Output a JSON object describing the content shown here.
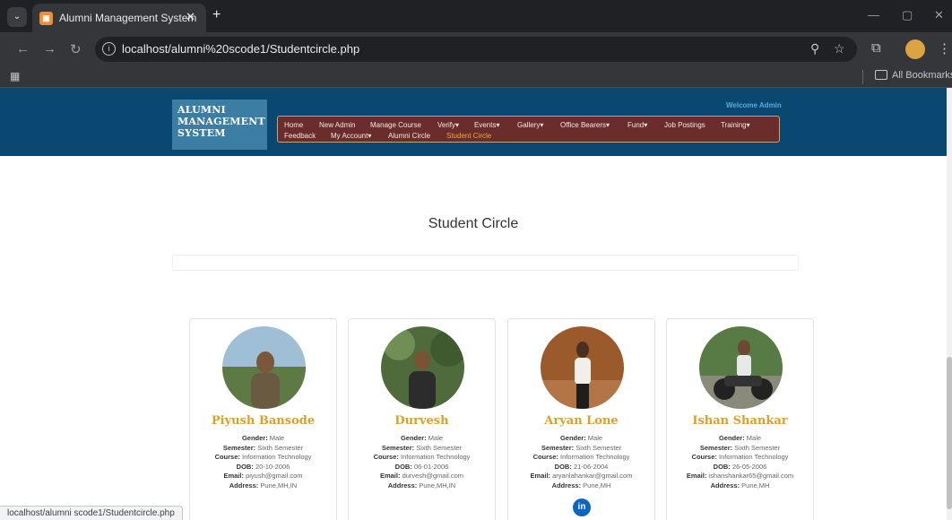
{
  "browser": {
    "tab_title": "Alumni Management System",
    "tab_close": "✕",
    "new_tab": "+",
    "url": "localhost/alumni%20scode1/Studentcircle.php",
    "bookmarks_label": "All Bookmarks",
    "status_url": "localhost/alumni scode1/Studentcircle.php"
  },
  "header": {
    "logo_lines": [
      "ALUMNI",
      "MANAGEMENT",
      "SYSTEM"
    ],
    "welcome": "Welcome Admin"
  },
  "nav": {
    "items": [
      {
        "label": "Home"
      },
      {
        "label": "New Admin"
      },
      {
        "label": "Manage Course"
      },
      {
        "label": "Verify▾"
      },
      {
        "label": "Events▾"
      },
      {
        "label": "Gallery▾"
      },
      {
        "label": "Office Bearers▾"
      },
      {
        "label": "Fund▾"
      },
      {
        "label": "Job Postings"
      },
      {
        "label": "Training▾"
      },
      {
        "label": "Feedback"
      },
      {
        "label": "My Account▾"
      },
      {
        "label": "Alumni Circle"
      },
      {
        "label": "Student Circle",
        "active": true
      }
    ]
  },
  "main": {
    "title": "Student Circle",
    "field_labels": {
      "gender": "Gender:",
      "semester": "Semester:",
      "course": "Course:",
      "dob": "DOB:",
      "email": "Email:",
      "address": "Address:"
    },
    "students": [
      {
        "name": "Piyush Bansode",
        "gender": "Male",
        "semester": "Sixth Semester",
        "course": "Information Technology",
        "dob": "20-10-2006",
        "email": "piyush@gmail.com",
        "address": "Pune,MH,IN"
      },
      {
        "name": "Durvesh",
        "gender": "Male",
        "semester": "Sixth Semester",
        "course": "Information Technology",
        "dob": "06-01-2006",
        "email": "durvesh@gmail.com",
        "address": "Pune,MH,IN"
      },
      {
        "name": "Aryan Lone",
        "gender": "Male",
        "semester": "Sixth Semester",
        "course": "Information Technology",
        "dob": "21-06-2004",
        "email": "aryanlahankar@gmail.com",
        "address": "Pune,MH",
        "linkedin_icon": "in"
      },
      {
        "name": "Ishan Shankar",
        "gender": "Male",
        "semester": "Sixth Semester",
        "course": "Information Technology",
        "dob": "26-05-2006",
        "email": "ishanshankar65@gmail.com",
        "address": "Pune,MH"
      }
    ]
  },
  "colors": {
    "header_bg": "#0a4871",
    "nav_bg": "#6b2c2c",
    "active_nav": "#f0a830",
    "name_gold": "#d9a02e"
  }
}
